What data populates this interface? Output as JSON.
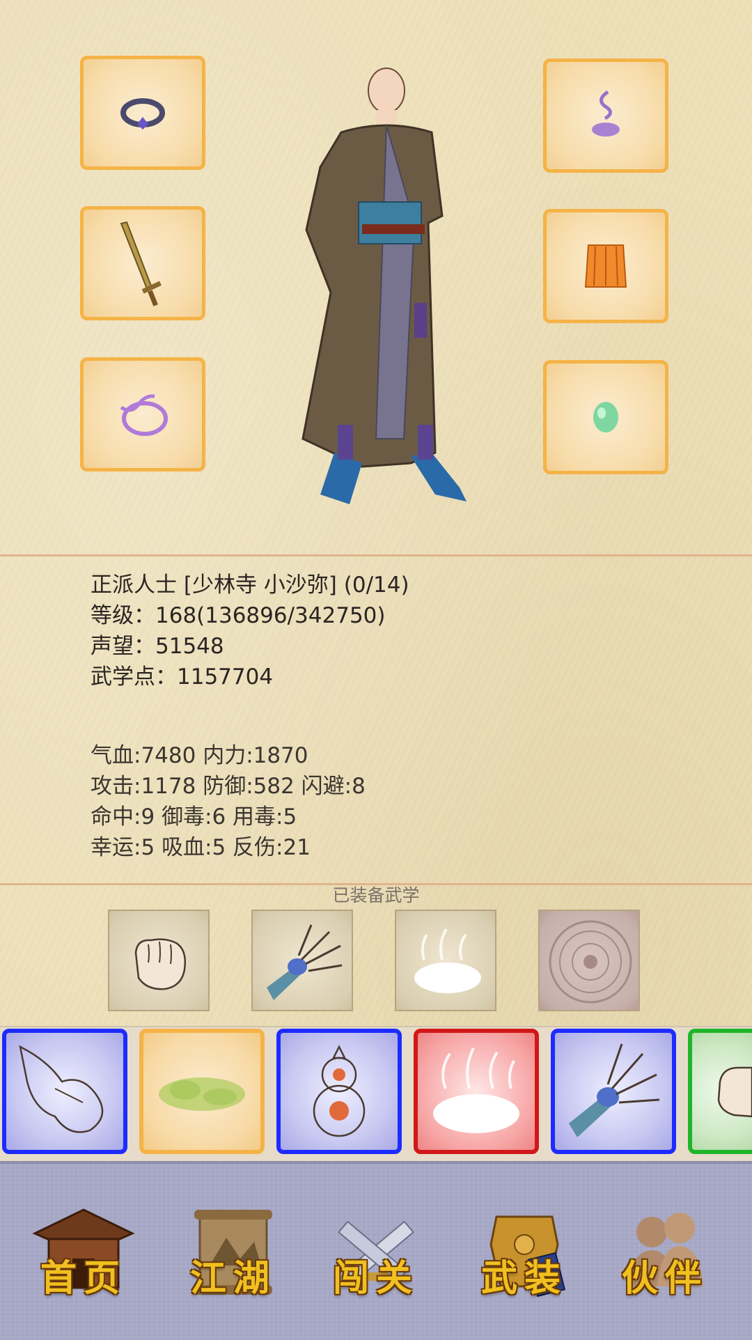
{
  "equipment": {
    "left": [
      {
        "icon": "ring-icon"
      },
      {
        "icon": "sword-icon"
      },
      {
        "icon": "bracelet-icon"
      }
    ],
    "right": [
      {
        "icon": "incense-icon"
      },
      {
        "icon": "armor-skirt-icon"
      },
      {
        "icon": "jade-icon"
      }
    ]
  },
  "character": {
    "icon": "monk-character"
  },
  "profile": {
    "title": "正派人士 [少林寺 小沙弥] (0/14)",
    "level": "等级：168(136896/342750)",
    "reputation": "声望：51548",
    "martial_points": "武学点：1157704"
  },
  "stats": {
    "line1": "气血:7480  内力:1870",
    "line2": "攻击:1178  防御:582  闪避:8",
    "line3": "命中:9  御毒:6  用毒:5",
    "line4": "幸运:5  吸血:5  反伤:21"
  },
  "equipped_skills": {
    "title": "已装备武学",
    "items": [
      {
        "icon": "fist-icon"
      },
      {
        "icon": "claw-hand-icon"
      },
      {
        "icon": "steam-cloud-icon"
      },
      {
        "icon": "stone-seal-icon"
      }
    ]
  },
  "skill_cards": [
    {
      "icon": "finger-point-icon",
      "color": "#1d2bff"
    },
    {
      "icon": "green-mist-icon",
      "color": "#f5b347"
    },
    {
      "icon": "gourd-icon",
      "color": "#1d2bff"
    },
    {
      "icon": "steam-cloud-icon",
      "color": "#d11818"
    },
    {
      "icon": "claw-hand-icon",
      "color": "#1d2bff"
    },
    {
      "icon": "fist-icon",
      "color": "#1fb52a"
    }
  ],
  "nav": {
    "home": "首页",
    "jianghu": "江湖",
    "challenge": "闯关",
    "equipment": "武装",
    "partner": "伙伴"
  }
}
